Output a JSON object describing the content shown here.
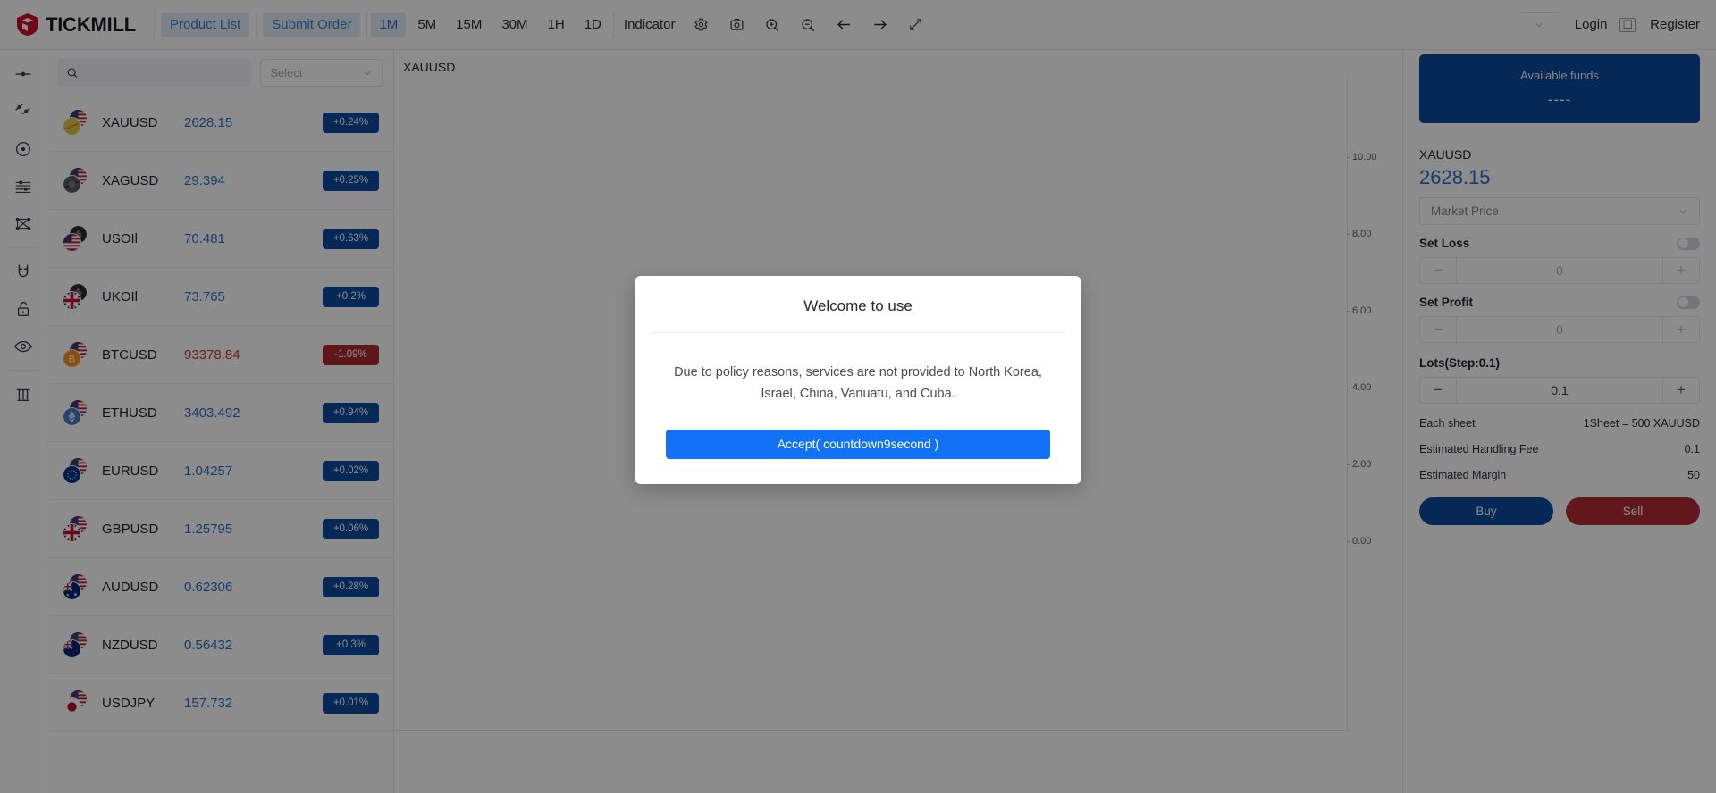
{
  "header": {
    "brand": "TICKMILL",
    "nav_buttons": [
      {
        "label": "Product List",
        "name": "product-list-button"
      },
      {
        "label": "Submit Order",
        "name": "submit-order-button"
      }
    ],
    "timeframes": [
      {
        "label": "1M",
        "active": true
      },
      {
        "label": "5M",
        "active": false
      },
      {
        "label": "15M",
        "active": false
      },
      {
        "label": "30M",
        "active": false
      },
      {
        "label": "1H",
        "active": false
      },
      {
        "label": "1D",
        "active": false
      }
    ],
    "indicator_label": "Indicator",
    "icons": [
      "gear-icon",
      "camera-icon",
      "zoom-in-icon",
      "zoom-out-icon",
      "arrow-left-icon",
      "arrow-right-icon",
      "fullscreen-icon"
    ],
    "login_label": "Login",
    "register_label": "Register",
    "account_select_value": ""
  },
  "rail": {
    "tools": [
      "cursor-line-icon",
      "trend-lines-icon",
      "circle-target-icon",
      "horizontal-lines-icon",
      "envelope-shape-icon",
      "magnet-icon",
      "unlock-icon",
      "eye-icon",
      "trash-icon"
    ]
  },
  "watchlist": {
    "search_placeholder": "",
    "search_value": "",
    "select_label": "Select",
    "rows": [
      {
        "symbol": "XAUUSD",
        "price": "2628.15",
        "change": "+0.24%",
        "negative": false,
        "flag_back": "us",
        "flag_front": "gold"
      },
      {
        "symbol": "XAGUSD",
        "price": "29.394",
        "change": "+0.25%",
        "negative": false,
        "flag_back": "us",
        "flag_front": "silver"
      },
      {
        "symbol": "USOIl",
        "price": "70.481",
        "change": "+0.63%",
        "negative": false,
        "flag_back": "oil",
        "flag_front": "us"
      },
      {
        "symbol": "UKOIl",
        "price": "73.765",
        "change": "+0.2%",
        "negative": false,
        "flag_back": "oil",
        "flag_front": "uk"
      },
      {
        "symbol": "BTCUSD",
        "price": "93378.84",
        "change": "-1.09%",
        "negative": true,
        "flag_back": "us",
        "flag_front": "btc"
      },
      {
        "symbol": "ETHUSD",
        "price": "3403.492",
        "change": "+0.94%",
        "negative": false,
        "flag_back": "us",
        "flag_front": "eth"
      },
      {
        "symbol": "EURUSD",
        "price": "1.04257",
        "change": "+0.02%",
        "negative": false,
        "flag_back": "us",
        "flag_front": "eu"
      },
      {
        "symbol": "GBPUSD",
        "price": "1.25795",
        "change": "+0.06%",
        "negative": false,
        "flag_back": "us",
        "flag_front": "uk"
      },
      {
        "symbol": "AUDUSD",
        "price": "0.62306",
        "change": "+0.28%",
        "negative": false,
        "flag_back": "us",
        "flag_front": "au"
      },
      {
        "symbol": "NZDUSD",
        "price": "0.56432",
        "change": "+0.3%",
        "negative": false,
        "flag_back": "us",
        "flag_front": "nz"
      },
      {
        "symbol": "USDJPY",
        "price": "157.732",
        "change": "+0.01%",
        "negative": false,
        "flag_back": "us",
        "flag_front": "jp"
      }
    ]
  },
  "chart": {
    "title": "XAUUSD"
  },
  "chart_data": {
    "type": "line",
    "title": "XAUUSD",
    "series": [
      {
        "name": "XAUUSD",
        "values": []
      }
    ],
    "x": [],
    "xlabel": "",
    "ylabel": "",
    "ylim": [
      0,
      10
    ],
    "yticks": [
      "10.00",
      "8.00",
      "6.00",
      "4.00",
      "2.00",
      "0.00"
    ],
    "grid": false,
    "legend": "none"
  },
  "trade": {
    "funds_label": "Available funds",
    "funds_value": "----",
    "symbol": "XAUUSD",
    "price": "2628.15",
    "order_type": "Market Price",
    "set_loss_label": "Set Loss",
    "set_loss_value": "0",
    "set_profit_label": "Set Profit",
    "set_profit_value": "0",
    "lots_label": "Lots(Step:0.1)",
    "lots_value": "0.1",
    "minus_label": "−",
    "plus_label": "+",
    "info": [
      {
        "label": "Each sheet",
        "value": "1Sheet = 500 XAUUSD"
      },
      {
        "label": "Estimated Handling Fee",
        "value": "0.1"
      },
      {
        "label": "Estimated Margin",
        "value": "50"
      }
    ],
    "buy_label": "Buy",
    "sell_label": "Sell"
  },
  "modal": {
    "title": "Welcome to use",
    "body": "Due to policy reasons, services are not provided to North Korea, Israel, China, Vanuatu, and Cuba.",
    "accept_label": "Accept( countdown9second )"
  },
  "colors": {
    "brand_red": "#c8102e",
    "accent_blue": "#2f6fc4",
    "badge_blue": "#0a4a9e",
    "badge_red": "#ad2832",
    "modal_button": "#1172f5"
  }
}
